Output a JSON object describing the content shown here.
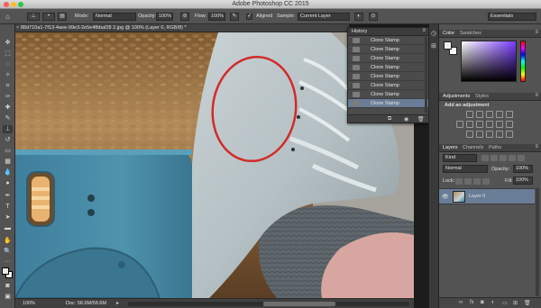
{
  "app": {
    "title": "Adobe Photoshop CC 2015"
  },
  "options_bar": {
    "mode_label": "Mode:",
    "mode_value": "Normal",
    "opacity_label": "Opacity:",
    "opacity_value": "100%",
    "flow_label": "Flow:",
    "flow_value": "100%",
    "aligned_label": "Aligned",
    "sample_label": "Sample:",
    "sample_value": "Current Layer",
    "workspace_value": "Essentials"
  },
  "document": {
    "tab_label": "88d710a1-7f13-4aee-99e3-2e5e4fbbaf28 2.jpg @ 100% (Layer 0, RGB/8) *",
    "zoom": "100%",
    "doc_size": "Doc: 58.6M/58.6M"
  },
  "history": {
    "title": "History",
    "items": [
      "Clone Stamp",
      "Clone Stamp",
      "Clone Stamp",
      "Clone Stamp",
      "Clone Stamp",
      "Clone Stamp",
      "Clone Stamp",
      "Clone Stamp"
    ],
    "selected_index": 7
  },
  "color_panel": {
    "tabs": [
      "Color",
      "Swatches"
    ]
  },
  "adjustments_panel": {
    "tabs": [
      "Adjustments",
      "Styles"
    ],
    "heading": "Add an adjustment"
  },
  "layers_panel": {
    "tabs": [
      "Layers",
      "Channels",
      "Paths"
    ],
    "kind_value": "Kind",
    "blend_value": "Normal",
    "opacity_label": "Opacity:",
    "opacity_value": "100%",
    "lock_label": "Lock:",
    "fill_label": "Fill:",
    "fill_value": "100%",
    "layer_name": "Layer 0"
  },
  "colors": {
    "panel_bg": "#535353",
    "selection": "#6a7d96",
    "annotation_red": "#d42a2a"
  }
}
